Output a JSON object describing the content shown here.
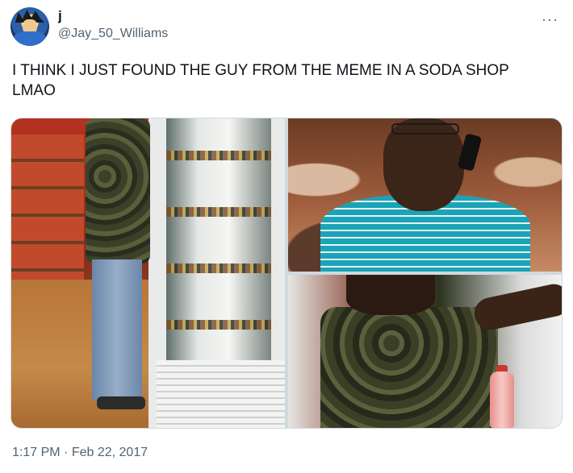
{
  "author": {
    "display_name": "j",
    "handle": "@Jay_50_Williams"
  },
  "tweet": {
    "text": "I THINK I JUST FOUND THE GUY FROM THE MEME IN A SODA SHOP LMAO",
    "time": "1:17 PM",
    "separator": " · ",
    "date": "Feb 22, 2017"
  },
  "icons": {
    "more": "more-options-icon"
  },
  "more_glyph": "···",
  "colors": {
    "text": "#0f1419",
    "secondary": "#536471",
    "border": "#cfd9de"
  }
}
